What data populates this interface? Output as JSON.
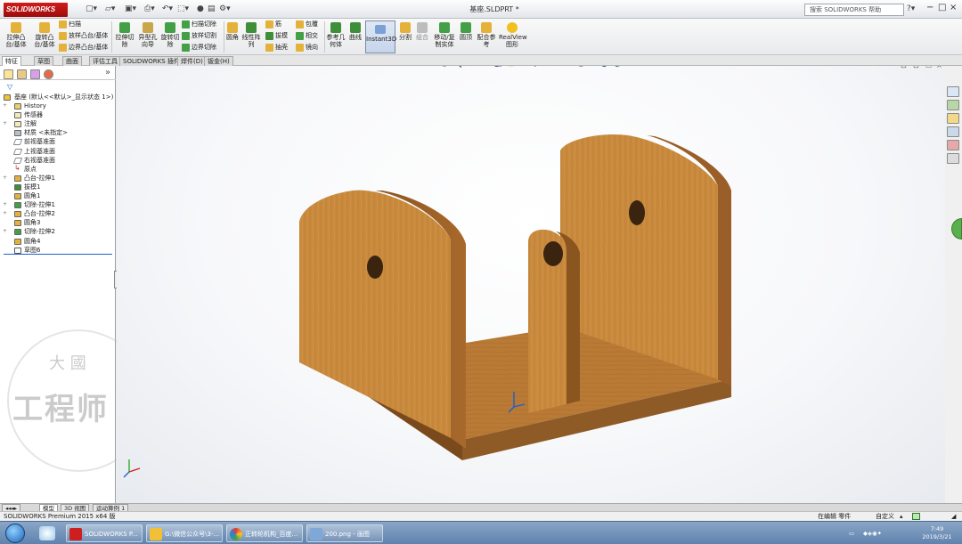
{
  "titlebar": {
    "app_logo": "SOLIDWORKS",
    "document_title": "基座.SLDPRT *",
    "help_search_placeholder": "搜索 SOLIDWORKS 帮助",
    "window_controls": [
      "?",
      "−",
      "□",
      "×"
    ]
  },
  "command_manager": {
    "features_col1": [
      {
        "label": "拉伸凸台/基体",
        "icon": "extrude-boss-icon",
        "color": "#e0b030"
      },
      {
        "label": "旋转凸台/基体",
        "icon": "revolve-boss-icon",
        "color": "#e0b030"
      }
    ],
    "features_col2": [
      "扫描",
      "放样凸台/基体",
      "边界凸台/基体"
    ],
    "features_col3": [
      {
        "label": "拉伸切除"
      },
      {
        "label": "异型孔向导"
      },
      {
        "label": "旋转切除"
      }
    ],
    "features_col4": [
      "扫描切除",
      "放样切割",
      "边界切除"
    ],
    "features_col5": [
      {
        "label": "圆角"
      },
      {
        "label": "线性阵列"
      }
    ],
    "features_col6": [
      "筋",
      "拔模",
      "抽壳"
    ],
    "features_col7": [
      "包覆",
      "相交",
      "镜向"
    ],
    "features_col8": [
      {
        "label": "参考几何体"
      },
      {
        "label": "曲线"
      }
    ],
    "instant3d": "Instant3D",
    "features_col9": [
      {
        "label": "分割"
      },
      {
        "label": "组合"
      },
      {
        "label": "移动/复制实体"
      },
      {
        "label": "圆顶"
      },
      {
        "label": "配合参考"
      },
      {
        "label": "RealView图形"
      }
    ]
  },
  "tabs": [
    "特征",
    "草图",
    "曲面",
    "评估工具",
    "SOLIDWORKS 插件",
    "焊件(D)",
    "钣金(H)"
  ],
  "active_tab": "特征",
  "feature_tree": {
    "root": "基座  (默认<<默认>_显示状态 1>)",
    "items": [
      "History",
      "传感器",
      "注解",
      "材质 <未指定>",
      "前视基准面",
      "上视基准面",
      "右视基准面",
      "原点",
      "凸台-拉伸1",
      "拔模1",
      "圆角1",
      "切除-拉伸1",
      "凸台-拉伸2",
      "圆角3",
      "切除-拉伸2",
      "圆角4",
      "草图6"
    ]
  },
  "watermark": {
    "line1": "大 國",
    "line2": "工程师"
  },
  "bottom_tabs": [
    "模型",
    "3D 视图",
    "运动算例 1"
  ],
  "statusbar": {
    "left": "SOLIDWORKS Premium 2015 x64 版",
    "editing": "在编辑 零件",
    "units": "自定义"
  },
  "taskbar": {
    "tasks": [
      {
        "label": "SOLIDWORKS P...",
        "color": "#cc2020"
      },
      {
        "label": "G:\\微信公众号\\3-...",
        "color": "#f2c037"
      },
      {
        "label": "正转轮机构_百度...",
        "color": "#4aa3df"
      },
      {
        "label": "200.png - 画图",
        "color": "#7fa7d8"
      }
    ],
    "time": "7:49",
    "date": "2019/3/21"
  },
  "colors": {
    "wood_light": "#c98a3e",
    "wood_dark": "#7a4a1d",
    "wood_edge": "#9a5f28",
    "accent_blue": "#1e5fcc"
  }
}
